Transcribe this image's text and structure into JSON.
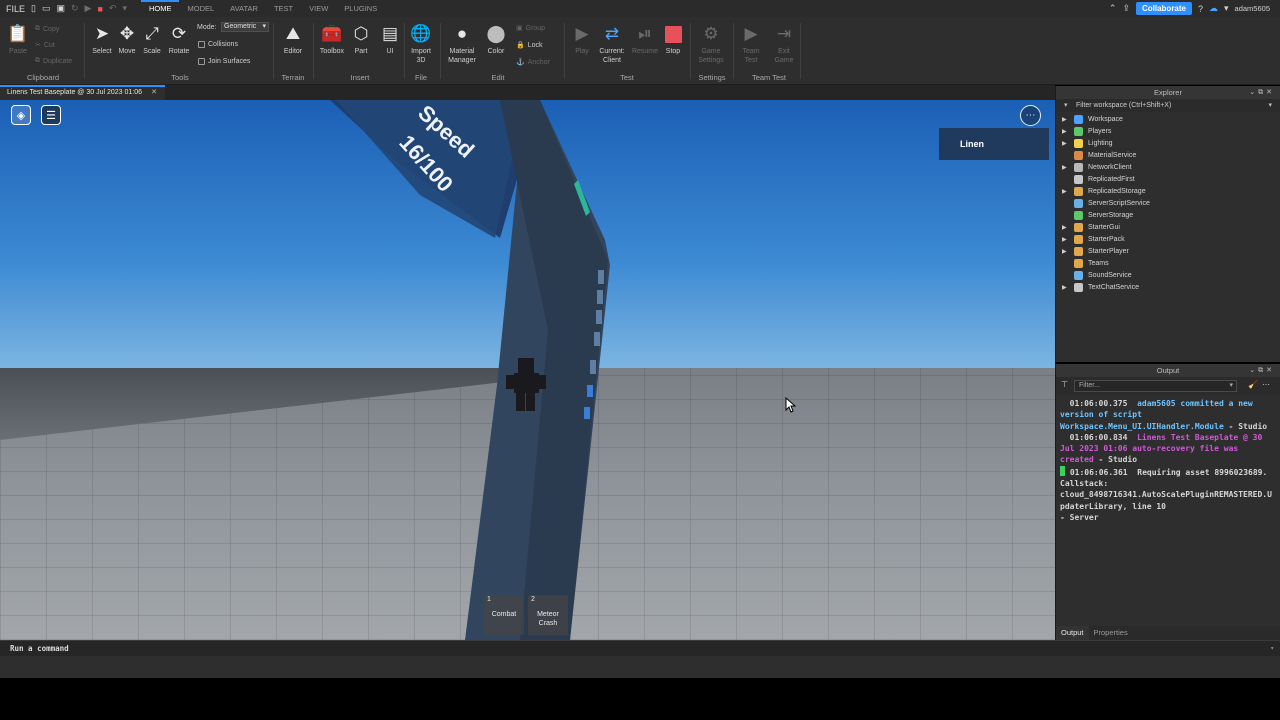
{
  "menubar": {
    "file_label": "FILE",
    "tabs": [
      {
        "label": "HOME",
        "active": true
      },
      {
        "label": "MODEL",
        "active": false
      },
      {
        "label": "AVATAR",
        "active": false
      },
      {
        "label": "TEST",
        "active": false
      },
      {
        "label": "VIEW",
        "active": false
      },
      {
        "label": "PLUGINS",
        "active": false
      }
    ],
    "collaborate_label": "Collaborate",
    "username": "adam5605"
  },
  "ribbon": {
    "clipboard": {
      "paste": "Paste",
      "copy": "Copy",
      "cut": "Cut",
      "duplicate": "Duplicate",
      "group": "Clipboard"
    },
    "tools": {
      "select": "Select",
      "move": "Move",
      "scale": "Scale",
      "rotate": "Rotate",
      "mode_label": "Mode:",
      "mode_value": "Geometric",
      "collisions": "Collisions",
      "join_surfaces": "Join Surfaces",
      "group": "Tools"
    },
    "terrain": {
      "editor": "Editor",
      "group": "Terrain"
    },
    "insert": {
      "toolbox": "Toolbox",
      "part": "Part",
      "ui": "UI",
      "group": "Insert"
    },
    "file": {
      "import3d": "Import 3D",
      "group": "File"
    },
    "edit": {
      "material_manager": "Material Manager",
      "color": "Color",
      "group_btn": "Group",
      "lock": "Lock",
      "anchor": "Anchor",
      "group": "Edit"
    },
    "test": {
      "play": "Play",
      "current_client": "Current: Client",
      "resume": "Resume",
      "stop": "Stop",
      "group": "Test"
    },
    "settings": {
      "game_settings": "Game Settings",
      "group": "Settings"
    },
    "team_test": {
      "team_test": "Team Test",
      "exit_game": "Exit Game",
      "group": "Team Test"
    }
  },
  "document_tab": {
    "title": "Linens Test Baseplate @ 30 Jul 2023 01:06"
  },
  "viewport": {
    "wall_text_top": "Speed",
    "wall_text_value": "16/100",
    "player_label": "Linen",
    "hotbar": [
      {
        "slot": "1",
        "name": "Combat"
      },
      {
        "slot": "2",
        "name": "Meteor Crash"
      }
    ]
  },
  "command_bar": {
    "placeholder": "Run a command"
  },
  "explorer": {
    "title": "Explorer",
    "filter_placeholder": "Filter workspace (Ctrl+Shift+X)",
    "items": [
      {
        "label": "Workspace",
        "expandable": true,
        "icon": "globe-icon",
        "color": "#4aa3ff"
      },
      {
        "label": "Players",
        "expandable": true,
        "icon": "players-icon",
        "color": "#5cc86a"
      },
      {
        "label": "Lighting",
        "expandable": true,
        "icon": "lightbulb-icon",
        "color": "#f2d14b"
      },
      {
        "label": "MaterialService",
        "expandable": false,
        "icon": "material-icon",
        "color": "#d98a4a"
      },
      {
        "label": "NetworkClient",
        "expandable": true,
        "icon": "network-icon",
        "color": "#b8b8b8"
      },
      {
        "label": "ReplicatedFirst",
        "expandable": false,
        "icon": "replicated-first-icon",
        "color": "#c7c7c7"
      },
      {
        "label": "ReplicatedStorage",
        "expandable": true,
        "icon": "replicated-storage-icon",
        "color": "#e0a84a"
      },
      {
        "label": "ServerScriptService",
        "expandable": false,
        "icon": "server-script-icon",
        "color": "#6ab0e8"
      },
      {
        "label": "ServerStorage",
        "expandable": false,
        "icon": "server-storage-icon",
        "color": "#5cc86a"
      },
      {
        "label": "StarterGui",
        "expandable": true,
        "icon": "starter-gui-icon",
        "color": "#e0a84a"
      },
      {
        "label": "StarterPack",
        "expandable": true,
        "icon": "starter-pack-icon",
        "color": "#e0a84a"
      },
      {
        "label": "StarterPlayer",
        "expandable": true,
        "icon": "starter-player-icon",
        "color": "#e0a84a"
      },
      {
        "label": "Teams",
        "expandable": false,
        "icon": "teams-icon",
        "color": "#e0a84a"
      },
      {
        "label": "SoundService",
        "expandable": false,
        "icon": "sound-icon",
        "color": "#6ab0e8"
      },
      {
        "label": "TextChatService",
        "expandable": true,
        "icon": "chat-icon",
        "color": "#c7c7c7"
      }
    ]
  },
  "output": {
    "title": "Output",
    "filter_placeholder": "Filter...",
    "log": {
      "l1_time": "01:06:00.375",
      "l1_msg": "adam5605 committed a new version of script Workspace.Menu_UI.UIHandler.Module",
      "l1_src": "  -  Studio",
      "l2_time": "01:06:00.834",
      "l2_msg": "Linens Test Baseplate @ 30 Jul 2023 01:06 auto-recovery file was created",
      "l2_src": "  -  Studio",
      "l3_time": "01:06:06.361",
      "l3_msg": "Requiring asset 8996023689.",
      "l4": "Callstack:",
      "l5": "cloud_8498716341.AutoScalePluginREMASTERED.UpdaterLibrary, line 10",
      "l6": "  -  Server"
    },
    "tabs": [
      "Output",
      "Properties"
    ]
  }
}
